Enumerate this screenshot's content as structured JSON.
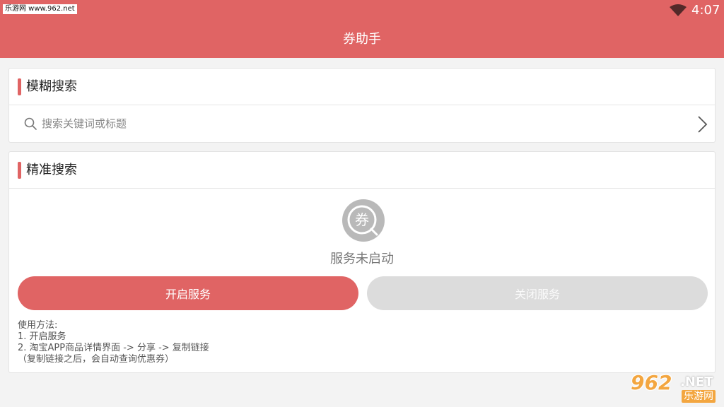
{
  "status_bar": {
    "watermark": "乐游网 www.962.net",
    "time": "4:07"
  },
  "app_bar": {
    "title": "券助手"
  },
  "fuzzy_search": {
    "heading": "模糊搜索",
    "placeholder": "搜索关键词或标题",
    "value": ""
  },
  "precise_search": {
    "heading": "精准搜索",
    "logo_glyph": "券",
    "service_status": "服务未启动",
    "start_button": "开启服务",
    "stop_button": "关闭服务",
    "usage": {
      "title": "使用方法:",
      "step1": "1. 开启服务",
      "step2": "2. 淘宝APP商品详情界面 -> 分享 -> 复制链接",
      "note": "（复制链接之后，会自动查询优惠券）"
    }
  },
  "watermark_br": {
    "number": "962",
    "domain": ".NET",
    "name": "乐游网"
  },
  "colors": {
    "accent": "#e06464",
    "disabled_button": "#dcdcdc",
    "background": "#f3f3f3"
  }
}
